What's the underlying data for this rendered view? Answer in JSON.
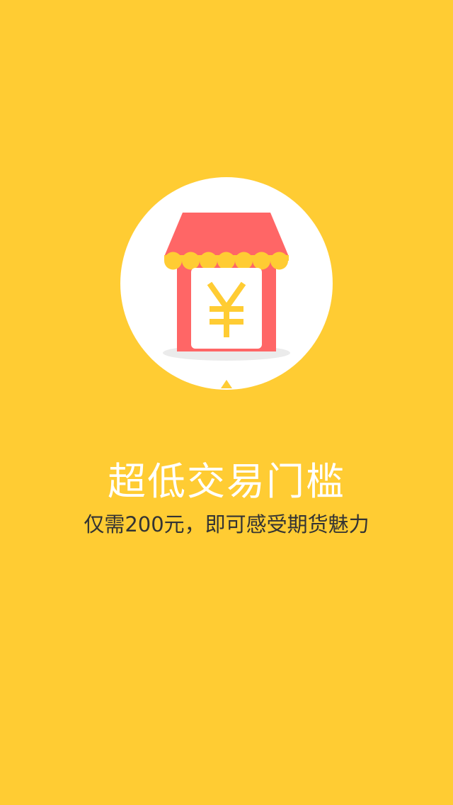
{
  "onboarding": {
    "headline": "超低交易门槛",
    "subline": "仅需200元，即可感受期货魅力",
    "icon": "storefront-yen-icon"
  },
  "colors": {
    "background": "#FFCC33",
    "circle": "#FFFFFF",
    "awning": "#FF6666",
    "awning_scallop": "#FFCC33",
    "shop_wall": "#FF6666",
    "yen_sign": "#FFCC33",
    "headline_text": "#FFFFFF",
    "subline_text": "#333333"
  }
}
